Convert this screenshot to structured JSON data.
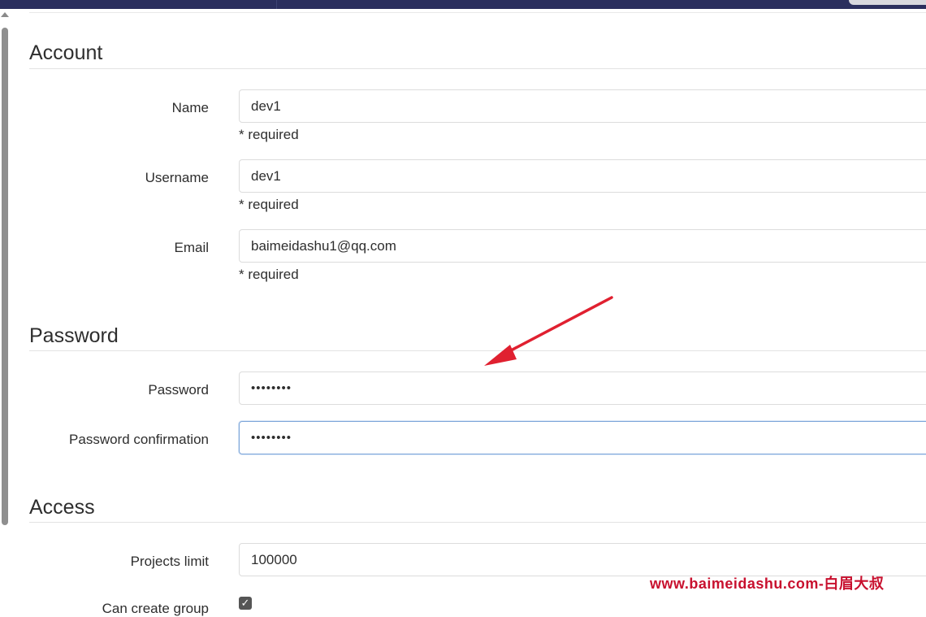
{
  "account": {
    "title": "Account",
    "name": {
      "label": "Name",
      "value": "dev1",
      "hint": "* required"
    },
    "username": {
      "label": "Username",
      "value": "dev1",
      "hint": "* required"
    },
    "email": {
      "label": "Email",
      "value": "baimeidashu1@qq.com",
      "hint": "* required"
    }
  },
  "password": {
    "title": "Password",
    "password": {
      "label": "Password",
      "value": "••••••••"
    },
    "confirmation": {
      "label": "Password confirmation",
      "value": "••••••••"
    }
  },
  "access": {
    "title": "Access",
    "projects_limit": {
      "label": "Projects limit",
      "value": "100000"
    },
    "can_create_group": {
      "label": "Can create group",
      "checked": true
    }
  },
  "watermark": "www.baimeidashu.com-白眉大叔",
  "colors": {
    "topbar": "#2b2f5e",
    "focus_border": "#7ea6d9",
    "annotation_arrow": "#e02030",
    "watermark": "#c8102e"
  },
  "icons": {
    "checkbox": "check-mark",
    "annotation": "red-arrow"
  }
}
